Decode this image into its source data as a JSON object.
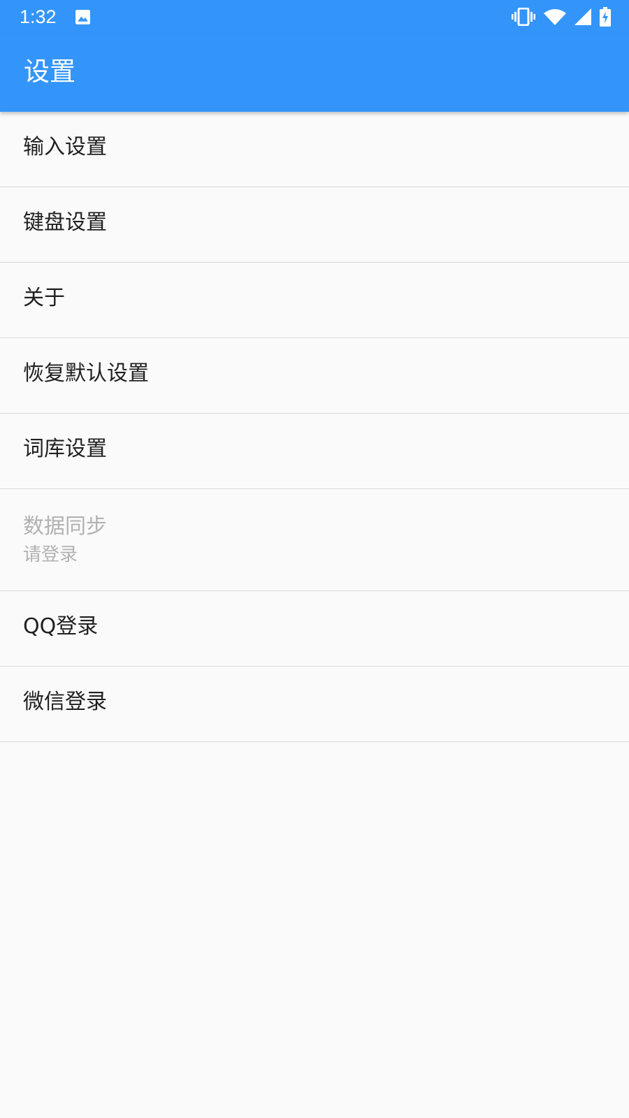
{
  "status_bar": {
    "time": "1:32",
    "icons": [
      "gallery-icon",
      "vibrate-icon",
      "wifi-icon",
      "signal-icon",
      "battery-charging-icon"
    ],
    "color": "#3395fa"
  },
  "app_bar": {
    "title": "设置",
    "color": "#3395fa"
  },
  "preferences": [
    {
      "title": "输入设置"
    },
    {
      "title": "键盘设置"
    },
    {
      "title": "关于"
    },
    {
      "title": "恢复默认设置"
    },
    {
      "title": "词库设置"
    },
    {
      "title": "数据同步",
      "summary": "请登录",
      "enabled": false
    },
    {
      "title": "QQ登录"
    },
    {
      "title": "微信登录"
    }
  ]
}
